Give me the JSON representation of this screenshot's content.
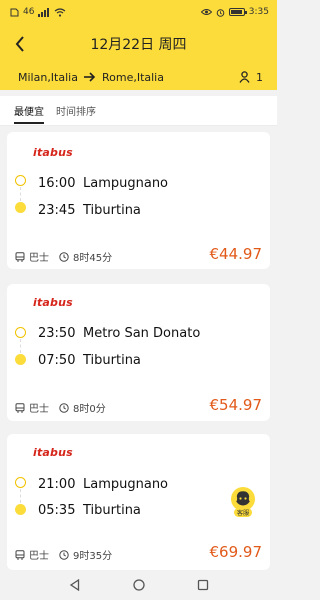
{
  "status_bar": {
    "signal_text": "46",
    "time": "3:35"
  },
  "header": {
    "title": "12月22日 周四"
  },
  "route": {
    "from": "Milan,Italia",
    "to": "Rome,Italia",
    "passenger_count": "1"
  },
  "sort_tabs": [
    {
      "label": "最便宜",
      "active": true
    },
    {
      "label": "时间排序",
      "active": false
    }
  ],
  "trips": [
    {
      "operator": "itabus",
      "depart_time": "16:00",
      "depart_station": "Lampugnano",
      "arrive_time": "23:45",
      "arrive_station": "Tiburtina",
      "vehicle": "巴士",
      "duration": "8时45分",
      "price": "€44.97"
    },
    {
      "operator": "itabus",
      "depart_time": "23:50",
      "depart_station": "Metro San Donato",
      "arrive_time": "07:50",
      "arrive_station": "Tiburtina",
      "vehicle": "巴士",
      "duration": "8时0分",
      "price": "€54.97"
    },
    {
      "operator": "itabus",
      "depart_time": "21:00",
      "depart_station": "Lampugnano",
      "arrive_time": "05:35",
      "arrive_station": "Tiburtina",
      "vehicle": "巴士",
      "duration": "9时35分",
      "price": "€69.97"
    }
  ],
  "customer_service": {
    "label": "客服"
  },
  "colors": {
    "accent_yellow": "#fcdc3a",
    "price_orange": "#e25a1a",
    "brand_red": "#d6261c"
  }
}
